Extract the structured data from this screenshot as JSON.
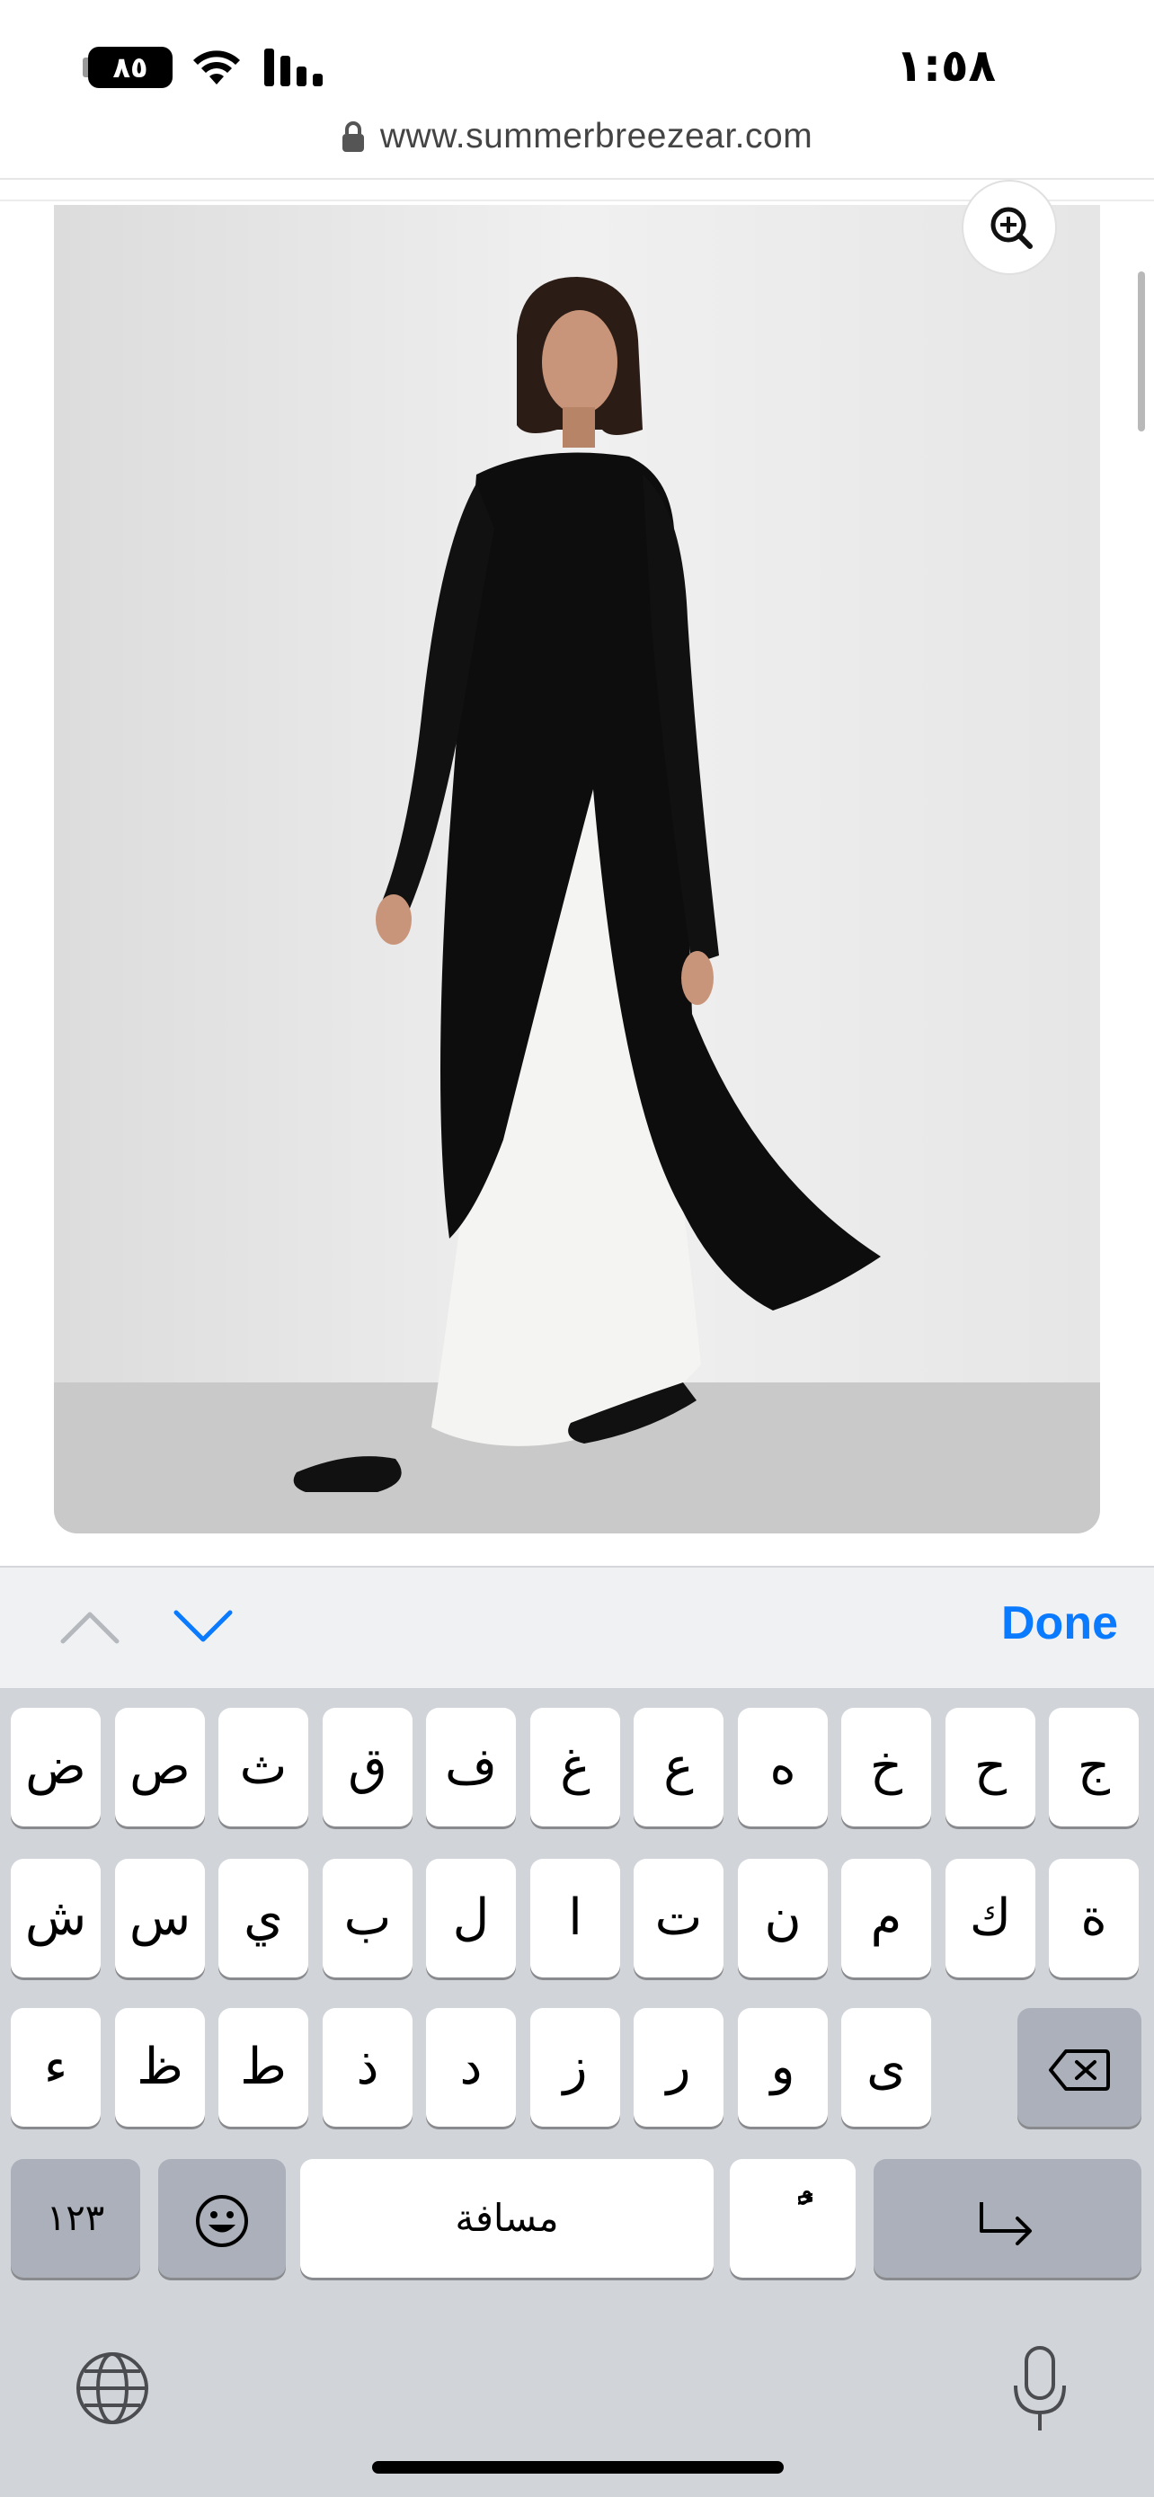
{
  "status_bar": {
    "battery_level": "٨٥",
    "time": "١:٥٨"
  },
  "browser": {
    "url": "www.summerbreezear.com"
  },
  "product": {
    "zoom_icon": "zoom-in-icon"
  },
  "accessory_bar": {
    "prev_icon": "chevron-up-icon",
    "next_icon": "chevron-down-icon",
    "done_label": "Done"
  },
  "keyboard": {
    "row1": [
      "ض",
      "ص",
      "ث",
      "ق",
      "ف",
      "غ",
      "ع",
      "ه",
      "خ",
      "ح",
      "ج"
    ],
    "row2": [
      "ش",
      "س",
      "ي",
      "ب",
      "ل",
      "ا",
      "ت",
      "ن",
      "م",
      "ك",
      "ة"
    ],
    "row3": [
      "ء",
      "ظ",
      "ط",
      "ذ",
      "د",
      "ز",
      "ر",
      "و",
      "ى"
    ],
    "numbers_label": "١٢٣",
    "space_label": "مسافة",
    "diacritic_label": "ًٌ",
    "emoji_icon": "emoji-icon",
    "delete_icon": "delete-icon",
    "return_icon": "return-icon",
    "globe_icon": "globe-icon",
    "mic_icon": "microphone-icon"
  },
  "colors": {
    "accent": "#0a7aff",
    "keyboard_bg": "#d1d4d9",
    "dark_key": "#abb0ba"
  }
}
